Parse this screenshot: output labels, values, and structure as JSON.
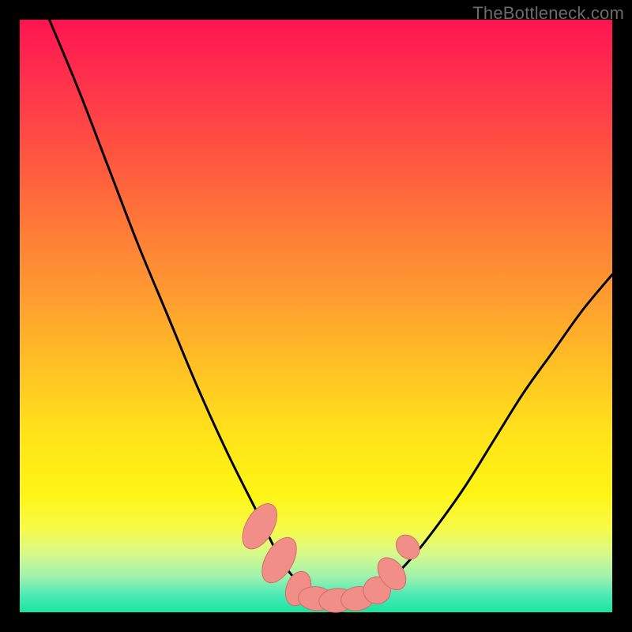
{
  "watermark": {
    "text": "TheBottleneck.com"
  },
  "colors": {
    "frame": "#000000",
    "curve": "#000000",
    "marker_fill": "#f08e87",
    "marker_stroke": "#d26e68"
  },
  "chart_data": {
    "type": "line",
    "title": "",
    "xlabel": "",
    "ylabel": "",
    "xlim": [
      0,
      100
    ],
    "ylim": [
      0,
      100
    ],
    "grid": false,
    "series": [
      {
        "name": "left-curve",
        "x": [
          5,
          10,
          15,
          20,
          25,
          30,
          35,
          40,
          44,
          47,
          49,
          51,
          53
        ],
        "y": [
          100,
          88,
          75,
          62,
          50,
          38,
          27,
          17,
          9,
          5,
          3,
          2,
          2
        ]
      },
      {
        "name": "right-curve",
        "x": [
          53,
          56,
          59,
          62,
          66,
          70,
          75,
          80,
          85,
          90,
          95,
          100
        ],
        "y": [
          2,
          2,
          3,
          5,
          9,
          14,
          21,
          29,
          37,
          44,
          51,
          57
        ]
      }
    ],
    "markers": [
      {
        "x": 40.5,
        "y": 14.5,
        "rx": 2.3,
        "ry": 4.2,
        "angle": 30
      },
      {
        "x": 43.8,
        "y": 8.8,
        "rx": 2.3,
        "ry": 4.2,
        "angle": 30
      },
      {
        "x": 47.0,
        "y": 4.0,
        "rx": 2.0,
        "ry": 3.0,
        "angle": 20
      },
      {
        "x": 50.0,
        "y": 2.3,
        "rx": 3.0,
        "ry": 2.0,
        "angle": 5
      },
      {
        "x": 53.5,
        "y": 2.0,
        "rx": 3.0,
        "ry": 2.0,
        "angle": -5
      },
      {
        "x": 57.0,
        "y": 2.3,
        "rx": 2.8,
        "ry": 2.0,
        "angle": -10
      },
      {
        "x": 60.3,
        "y": 3.7,
        "rx": 2.3,
        "ry": 2.3,
        "angle": -20
      },
      {
        "x": 62.8,
        "y": 6.5,
        "rx": 2.0,
        "ry": 3.0,
        "angle": -35
      },
      {
        "x": 65.5,
        "y": 11.0,
        "rx": 1.8,
        "ry": 2.2,
        "angle": -40
      }
    ]
  }
}
